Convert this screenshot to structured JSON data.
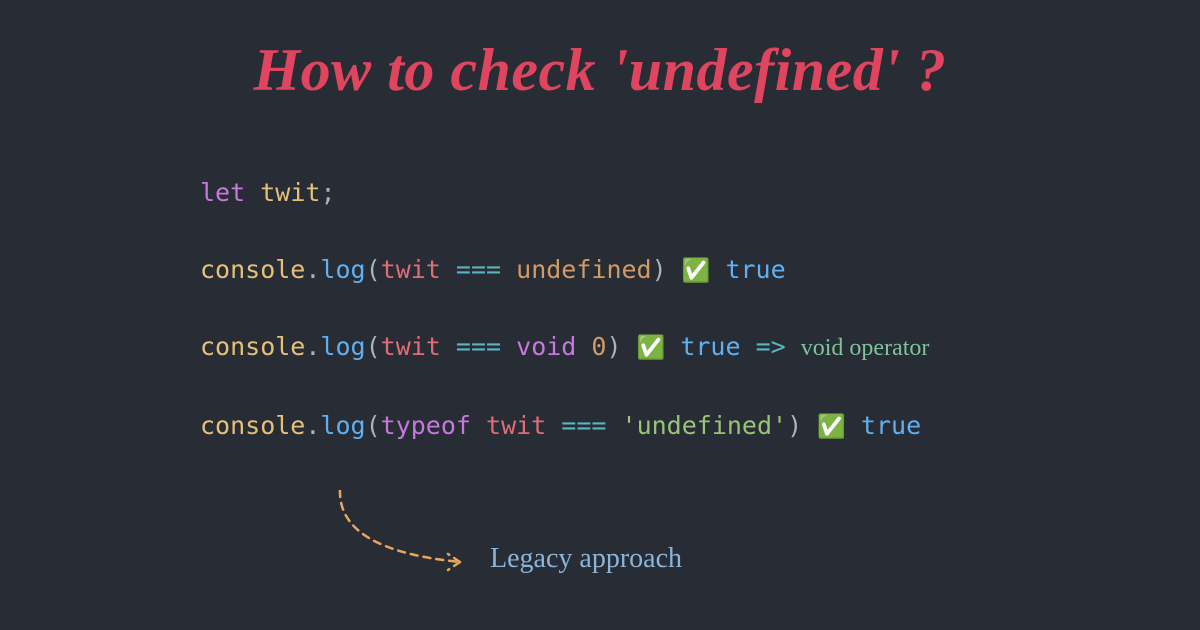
{
  "title": "How to check 'undefined' ?",
  "code": {
    "line1": {
      "kw_let": "let",
      "ident": "twit",
      "semi": ";"
    },
    "line2": {
      "obj": "console",
      "dot": ".",
      "method": "log",
      "open": "(",
      "arg": "twit",
      "op": "===",
      "undef": "undefined",
      "close": ")",
      "check": "✅",
      "result": "true"
    },
    "line3": {
      "obj": "console",
      "dot": ".",
      "method": "log",
      "open": "(",
      "arg": "twit",
      "op": "===",
      "kw_void": "void",
      "num": "0",
      "close": ")",
      "check": "✅",
      "result": "true",
      "arrow": "=>",
      "note": "void operator"
    },
    "line4": {
      "obj": "console",
      "dot": ".",
      "method": "log",
      "open": "(",
      "kw_typeof": "typeof",
      "arg": "twit",
      "op": "===",
      "str": "'undefined'",
      "close": ")",
      "check": "✅",
      "result": "true"
    }
  },
  "annotation": {
    "legacy": "Legacy approach"
  },
  "colors": {
    "background": "#282c34",
    "title": "#e0455f",
    "keyword": "#c678dd",
    "identifier": "#e5c07b",
    "method": "#61afef",
    "operator": "#56b6c2",
    "literal": "#d19a66",
    "string": "#98c379",
    "variable": "#e06c75",
    "annotation_arrow": "#e8a55f",
    "annotation_text": "#8ab4d8"
  }
}
